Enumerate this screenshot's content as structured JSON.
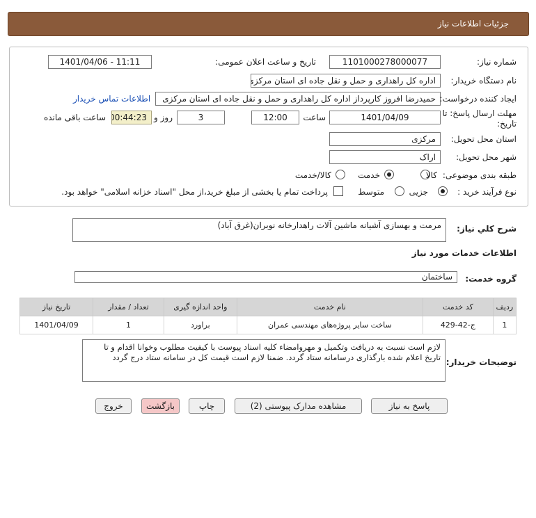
{
  "header": {
    "title": "جزئیات اطلاعات نیاز"
  },
  "form": {
    "need_number_label": "شماره نیاز:",
    "need_number": "1101000278000077",
    "announce_label": "تاریخ و ساعت اعلان عمومی:",
    "announce_value": "1401/04/06 - 11:11",
    "buyer_org_label": "نام دستگاه خریدار:",
    "buyer_org": "اداره کل راهداری و حمل و نقل جاده ای استان مرکزی",
    "requester_label": "ایجاد کننده درخواست:",
    "requester": "حمیدرضا  افروز  کارپرداز اداره کل راهداری و حمل و نقل جاده ای استان مرکزی",
    "contact_link": "اطلاعات تماس خریدار",
    "deadline_label": "مهلت ارسال پاسخ: تا تاریخ:",
    "deadline_date": "1401/04/09",
    "time_label": "ساعت",
    "deadline_time": "12:00",
    "days_value": "3",
    "days_label": "روز و",
    "remaining_time": "00:44:23",
    "remaining_label": "ساعت باقی مانده",
    "province_label": "استان محل تحویل:",
    "province": "مرکزی",
    "city_label": "شهر محل تحویل:",
    "city": "اراک",
    "category_label": "طبقه بندی موضوعی:",
    "category_options": [
      "کالا",
      "خدمت",
      "کالا/خدمت"
    ],
    "category_selected": "خدمت",
    "process_label": "نوع فرآیند خرید :",
    "process_options": [
      "جزیی",
      "متوسط"
    ],
    "process_selected": "جزیی",
    "payment_note": "پرداخت تمام یا بخشی از مبلغ خرید،از محل \"اسناد خزانه اسلامی\" خواهد بود."
  },
  "summary": {
    "label": "شرح کلي نياز:",
    "value": "مرمت و بهسازی آشیانه ماشین آلات راهدارخانه نوبران(غرق آباد)"
  },
  "services": {
    "section_title": "اطلاعات خدمات مورد نیاز",
    "group_label": "گروه خدمت:",
    "group_value": "ساختمان",
    "columns": [
      "ردیف",
      "کد خدمت",
      "نام خدمت",
      "واحد اندازه گیری",
      "تعداد / مقدار",
      "تاریخ نیاز"
    ],
    "rows": [
      [
        "1",
        "ج-42-429",
        "ساخت سایر پروژه‌های مهندسی عمران",
        "براورد",
        "1",
        "1401/04/09"
      ]
    ]
  },
  "buyer_notes": {
    "label": "توضیحات خریدار:",
    "text": "لازم است نسبت به دریافت وتکمیل و مهروامضاء کلیه اسناد پیوست با کیفیت مطلوب وخوانا اقدام و تا تاریخ اعلام شده بارگذاری درسامانه ستاد گردد. ضمنا لازم است قیمت کل در سامانه ستاد درج گردد"
  },
  "buttons": {
    "reply": "پاسخ به نیاز",
    "attachments": "مشاهده مدارک پیوستی (2)",
    "print": "چاپ",
    "back": "بازگشت",
    "exit": "خروج"
  }
}
